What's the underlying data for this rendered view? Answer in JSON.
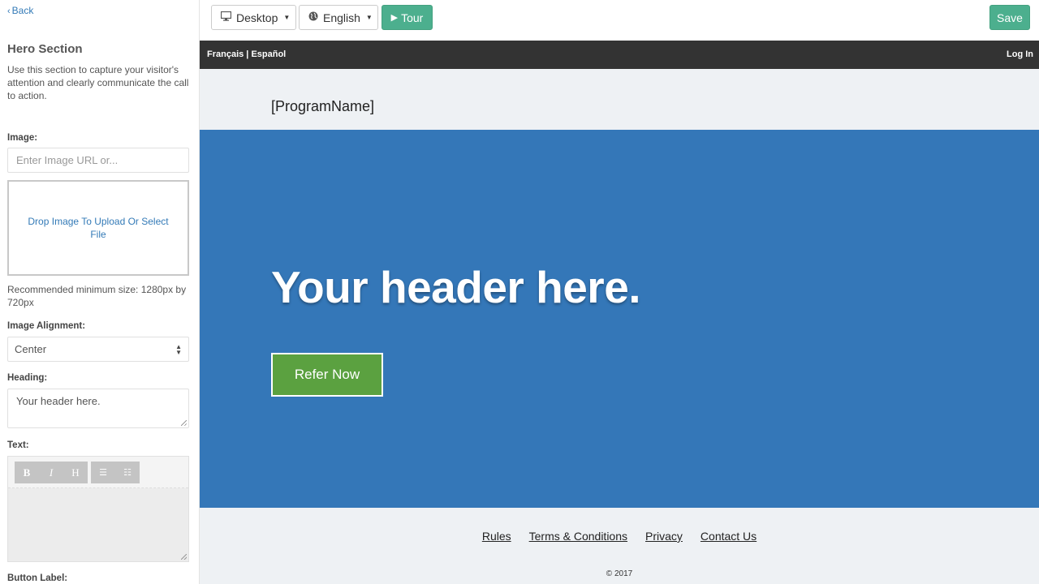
{
  "sidebar": {
    "back_label": "Back",
    "section_title": "Hero Section",
    "section_description": "Use this section to capture your visitor's attention and clearly communicate the call to action.",
    "image_label": "Image:",
    "image_url_placeholder": "Enter Image URL or...",
    "dropzone_text": "Drop Image To Upload Or Select File",
    "image_hint": "Recommended minimum size: 1280px by 720px",
    "alignment_label": "Image Alignment:",
    "alignment_value": "Center",
    "heading_label": "Heading:",
    "heading_value": "Your header here.",
    "text_label": "Text:",
    "editor_buttons": {
      "bold": "B",
      "italic": "I",
      "heading": "H"
    },
    "button_label_label": "Button Label:"
  },
  "toolbar": {
    "device_label": "Desktop",
    "language_label": "English",
    "tour_label": "Tour",
    "save_label": "Save"
  },
  "preview": {
    "lang_french": "Français",
    "lang_separator": " | ",
    "lang_spanish": "Español",
    "login": "Log In",
    "program_name": "[ProgramName]",
    "hero_heading": "Your header here.",
    "cta_label": "Refer Now",
    "footer_links": [
      "Rules",
      "Terms & Conditions",
      "Privacy",
      "Contact Us"
    ],
    "copyright": "© 2017"
  },
  "colors": {
    "accent_green": "#4caf8e",
    "hero_blue": "#3477b8",
    "cta_green": "#5ba140",
    "nav_dark": "#333333",
    "link_blue": "#337ab7"
  },
  "icons": [
    "chevron-left-icon",
    "monitor-icon",
    "globe-icon",
    "caret-down-icon",
    "play-icon",
    "select-arrows-icon",
    "resize-grip-icon",
    "bullet-list-icon",
    "numbered-list-icon"
  ]
}
